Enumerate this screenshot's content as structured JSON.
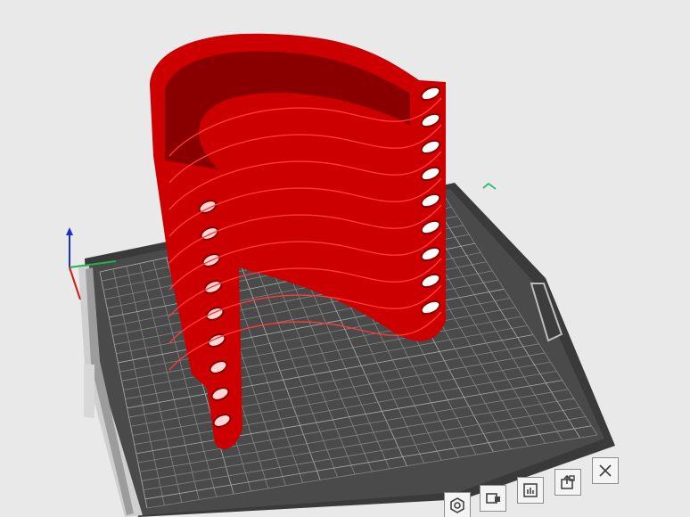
{
  "app": {
    "view": "3D plater"
  },
  "scene": {
    "model_color": "#cc0000",
    "model_shadow": "#8a0000",
    "model_highlight": "#ff3a3a",
    "bed_color": "#4a4a4a",
    "bed_grid_color": "#9a9a9a",
    "background": "#e9e9e9",
    "axis_x_color": "#d11a1a",
    "axis_y_color": "#1fb34a",
    "axis_z_color": "#1c2fd6"
  },
  "toolbar": {
    "items": [
      {
        "icon": "hex-nut-icon",
        "label": ""
      },
      {
        "icon": "object-icon",
        "label": ""
      },
      {
        "icon": "layers-icon",
        "label": ""
      },
      {
        "icon": "export-icon",
        "label": ""
      },
      {
        "icon": "close-icon",
        "label": ""
      }
    ]
  }
}
